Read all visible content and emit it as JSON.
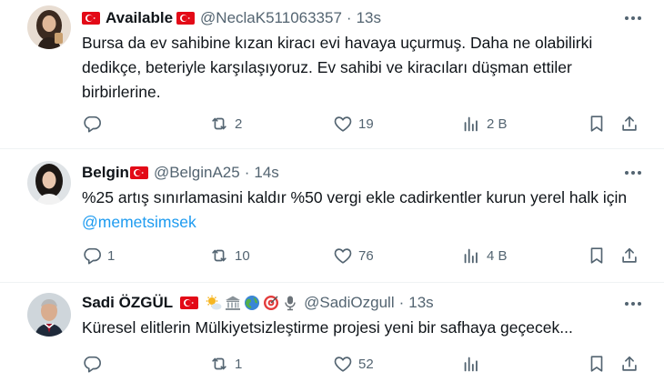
{
  "tweets": [
    {
      "name": "Available",
      "handle": "@NeclaK511063357",
      "dot": "·",
      "time": "13s",
      "text": "Bursa da ev sahibine kızan kiracı evi havaya uçurmuş. Daha ne olabilirki dedikçe, beteriyle karşılaşıyoruz. Ev sahibi ve kiracıları düşman ettiler birbirlerine.",
      "replies": "",
      "reposts": "2",
      "likes": "19",
      "views": "2 B"
    },
    {
      "name": "Belgin",
      "handle": "@BelginA25",
      "dot": "·",
      "time": "14s",
      "text": "%25 artış sınırlamasini kaldır %50 vergi ekle cadirkentler kurun yerel halk için ",
      "mention": "@memetsimsek",
      "replies": "1",
      "reposts": "10",
      "likes": "76",
      "views": "4 B"
    },
    {
      "name": "Sadi ÖZGÜL",
      "handle": "@SadiOzgull",
      "dot": "·",
      "time": "13s",
      "text": "Küresel elitlerin Mülkiyetsizleştirme projesi yeni bir safhaya geçecek...",
      "replies": "",
      "reposts": "1",
      "likes": "52",
      "views": ""
    }
  ],
  "colors": {
    "text": "#0f1419",
    "secondary": "#536471",
    "link": "#1d9bf0",
    "flag": "#e30a17",
    "divider": "#eff3f4"
  }
}
